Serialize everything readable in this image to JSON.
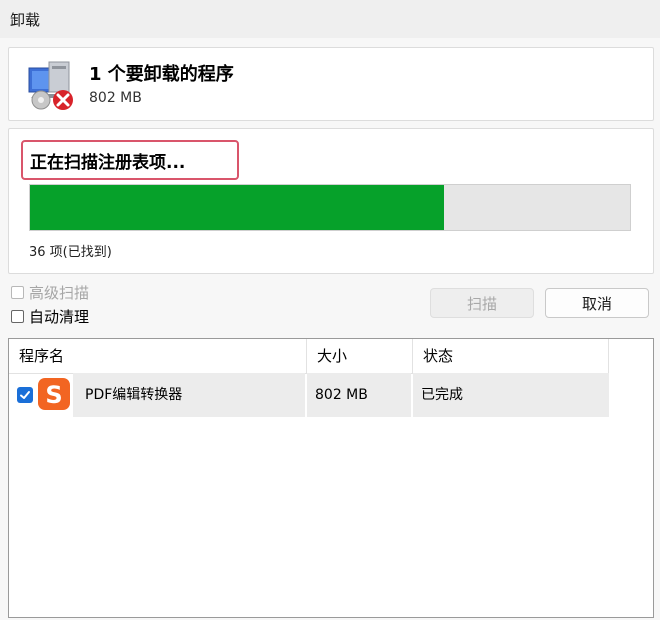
{
  "window": {
    "title": "卸载"
  },
  "header": {
    "title": "1 个要卸载的程序",
    "size": "802 MB",
    "icon": "uninstall-program-icon"
  },
  "scan": {
    "status": "正在扫描注册表项...",
    "progress": 0.69,
    "found": "36 项(已找到)"
  },
  "options": {
    "advanced_scan": "高级扫描",
    "auto_clean": "自动清理"
  },
  "buttons": {
    "scan": "扫描",
    "cancel": "取消"
  },
  "list": {
    "columns": [
      "程序名",
      "大小",
      "状态"
    ],
    "rows": [
      {
        "name": "PDF编辑转换器",
        "size": "802 MB",
        "status": "已完成",
        "checked": true,
        "icon": "sogou-s-icon"
      }
    ]
  },
  "colors": {
    "progress": "#06a12a",
    "highlight": "#d9556b",
    "check": "#1a6fd8",
    "app_icon": "#f26522"
  }
}
